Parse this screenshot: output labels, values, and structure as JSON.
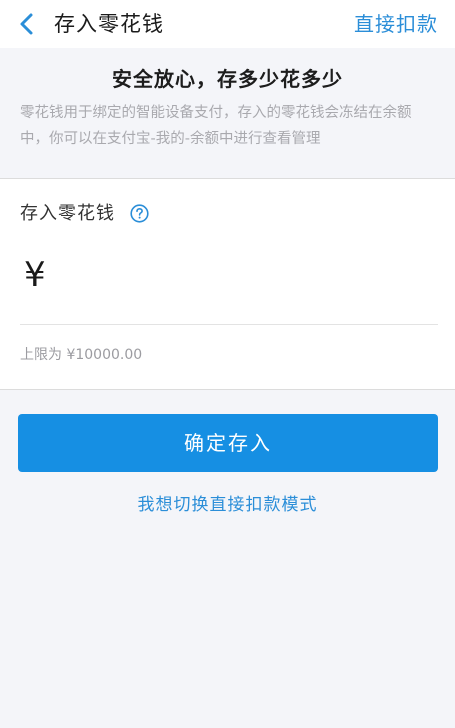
{
  "header": {
    "title": "存入零花钱",
    "action_label": "直接扣款"
  },
  "notice": {
    "title": "安全放心，存多少花多少",
    "description": "零花钱用于绑定的智能设备支付，存入的零花钱会冻结在余额中，你可以在支付宝-我的-余额中进行查看管理"
  },
  "deposit": {
    "label": "存入零花钱",
    "currency_symbol": "¥",
    "amount_value": "",
    "limit_text": "上限为 ¥10000.00"
  },
  "actions": {
    "confirm_label": "确定存入",
    "switch_mode_label": "我想切换直接扣款模式"
  },
  "icons": {
    "back": "chevron-left-icon",
    "help": "question-circle-icon"
  },
  "colors": {
    "accent": "#2b8ed8",
    "primary_button": "#168fe3",
    "page_background": "#f4f5f9",
    "muted_text": "#a9a9ae"
  }
}
